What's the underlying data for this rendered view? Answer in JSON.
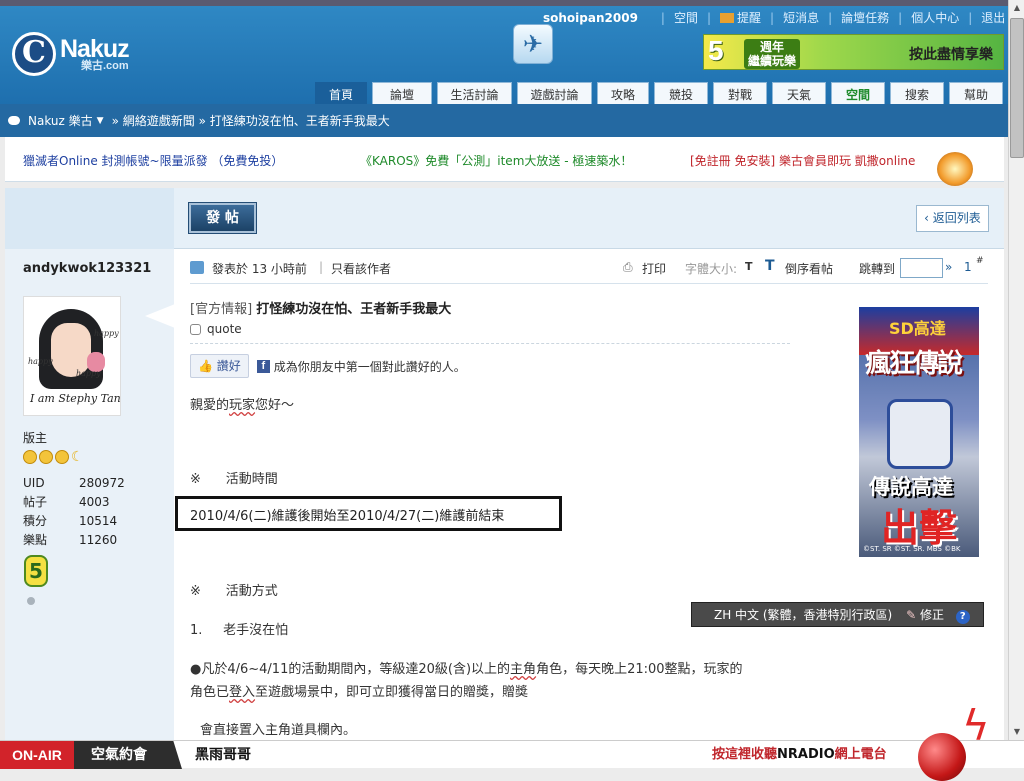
{
  "header": {
    "logo_text": "Nakuz",
    "logo_sub": "樂古.com",
    "username": "sohoipan2009",
    "links": [
      "空間",
      "提醒",
      "短消息",
      "論壇任務",
      "個人中心",
      "退出"
    ],
    "banner": {
      "number": "5",
      "title_line1": "週年",
      "title_line2": "繼續玩樂",
      "slogan": "按此盡情享樂"
    }
  },
  "nav": {
    "tabs": [
      "首頁",
      "論壇",
      "生活討論",
      "遊戲討論",
      "攻略",
      "競投",
      "對戰",
      "天氣",
      "空間",
      "搜索",
      "幫助"
    ],
    "active": "首頁"
  },
  "breadcrumb": {
    "site": "Nakuz 樂古",
    "items": [
      "網絡遊戲新聞",
      "打怪練功沒在怕、王者新手我最大"
    ],
    "separator": "»"
  },
  "ads": [
    {
      "text": "獵滅者Online 封測帳號~限量派發 （免費免投）",
      "color": "#1d3fa0"
    },
    {
      "text": "《KAROS》免費「公測」item大放送 - 極速築水！",
      "color": "#1e8a2a"
    },
    {
      "text": "[免註冊 免安裝] 樂古會員即玩 凱撒online",
      "color": "#c0262c"
    }
  ],
  "actions": {
    "post_button": "發 帖",
    "back_button": "返回列表"
  },
  "author": {
    "name": "andykwok123321",
    "avatar_caption": "I am Stephy Tang",
    "avatar_small": [
      "happy",
      "happy",
      "happy"
    ],
    "rank": "版主",
    "stats": [
      {
        "label": "UID",
        "value": "280972"
      },
      {
        "label": "帖子",
        "value": "4003"
      },
      {
        "label": "積分",
        "value": "10514"
      },
      {
        "label": "樂點",
        "value": "11260"
      }
    ],
    "medal": "5"
  },
  "post_info": {
    "posted": "發表於 13 小時前",
    "only_author": "只看該作者",
    "print": "打印",
    "font_size_label": "字體大小:",
    "font_t": "T",
    "reverse": "倒序看帖",
    "jump_to": "跳轉到",
    "jump_arrow": "»",
    "floor": "1",
    "floor_mark": "#"
  },
  "post": {
    "category": "[官方情報]",
    "title": "打怪練功沒在怕、王者新手我最大",
    "tag": "quote",
    "like_button": "讚好",
    "like_text": "成為你朋友中第一個對此讚好的人。",
    "greeting_pre": "親愛的",
    "greeting_u": "玩家",
    "greeting_post": "您好～",
    "section1_mark": "※",
    "section1": "活動時間",
    "period": "2010/4/6(二)維護後開始至2010/4/27(二)維護前結束",
    "section2_mark": "※",
    "section2": "活動方式",
    "item1_num": "1.",
    "item1": "老手沒在怕",
    "line1_pre": "●凡於4/6~4/11的活動期間內，等級達20級(含)以上的",
    "line1_u": "主角",
    "line1_post": "角色，每天晚上21:00整點，玩家的",
    "line2_pre": "角色已",
    "line2_u": "登入",
    "line2_post": "至遊戲場景中，即可立即獲得當日的贈獎，贈獎",
    "line3": "會直接置入主角道具欄內。"
  },
  "game_ad": {
    "top": "SD高達",
    "title": "瘋狂傳說",
    "line": "傳說高達",
    "big": "出擊",
    "copyright": "©ST. SR ©ST. SR. MBS ©BK"
  },
  "ime": {
    "text": "ZH 中文 (繁體，香港特別行政區)",
    "fix": "修正",
    "help": "?"
  },
  "radio": {
    "onair": "ON-AIR",
    "program1": "空氣約會",
    "program2": "黑雨哥哥",
    "cta_pre": "按這裡收聽",
    "cta_brand": "NRADIO",
    "cta_post": "網上電台"
  }
}
